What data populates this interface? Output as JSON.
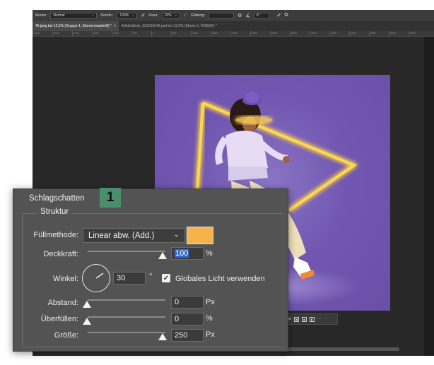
{
  "options_bar": {
    "mode_label": "Modus:",
    "mode_value": "Normal",
    "opacity_label": "Deckkr.:",
    "opacity_value": "100%",
    "flow_label": "Fluss:",
    "flow_value": "20%",
    "smoothing_label": "Glättung:",
    "angle_value": "0°"
  },
  "tabs": [
    {
      "label": "46.jpeg bei 12,5% (Gruppe 1, Ebenenmaske/8) *",
      "active": true
    },
    {
      "label": "AdobeStock_562016546.psd bei 12,5% (Ebene 1, RGB/8#) *",
      "active": false
    }
  ],
  "ruler_ticks": [
    "3000",
    "2500",
    "2000",
    "1500",
    "1000",
    "500",
    "0",
    "500",
    "1000",
    "1500",
    "2000",
    "2500",
    "3000",
    "3500",
    "4000",
    "4500",
    "5000",
    "5500",
    "6000",
    "6500"
  ],
  "context_bar": {
    "label": "sk"
  },
  "panel": {
    "title": "Schlagschatten",
    "badge": "1",
    "group_title": "Struktur",
    "blend_mode_label": "Füllmethode:",
    "blend_mode_value": "Linear abw. (Add.)",
    "swatch_color": "#f7b24b",
    "opacity_label": "Deckkraft:",
    "opacity_value": "100",
    "opacity_unit": "%",
    "angle_label": "Winkel:",
    "angle_value": "30",
    "angle_unit": "°",
    "global_light_label": "Globales Licht verwenden",
    "global_light_checked": true,
    "distance_label": "Abstand:",
    "distance_value": "0",
    "distance_unit": "Px",
    "spread_label": "Überfüllen:",
    "spread_value": "0",
    "spread_unit": "%",
    "size_label": "Größe:",
    "size_value": "250",
    "size_unit": "Px"
  }
}
